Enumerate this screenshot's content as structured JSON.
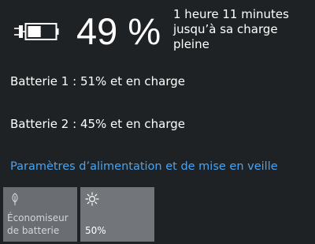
{
  "summary": {
    "percent": "49 %",
    "time_remaining": "1 heure 11 minutes jusqu’à sa charge pleine",
    "charge_level": 0.49
  },
  "batteries": [
    {
      "label": "Batterie 1 : 51% et en charge"
    },
    {
      "label": "Batterie 2 : 45% et en charge"
    }
  ],
  "settings_link": "Paramètres d’alimentation et de mise en veille",
  "tiles": [
    {
      "label": "Économiseur de batterie",
      "icon": "leaf-icon",
      "active": false
    },
    {
      "label": "50%",
      "icon": "brightness-icon",
      "active": false
    }
  ]
}
